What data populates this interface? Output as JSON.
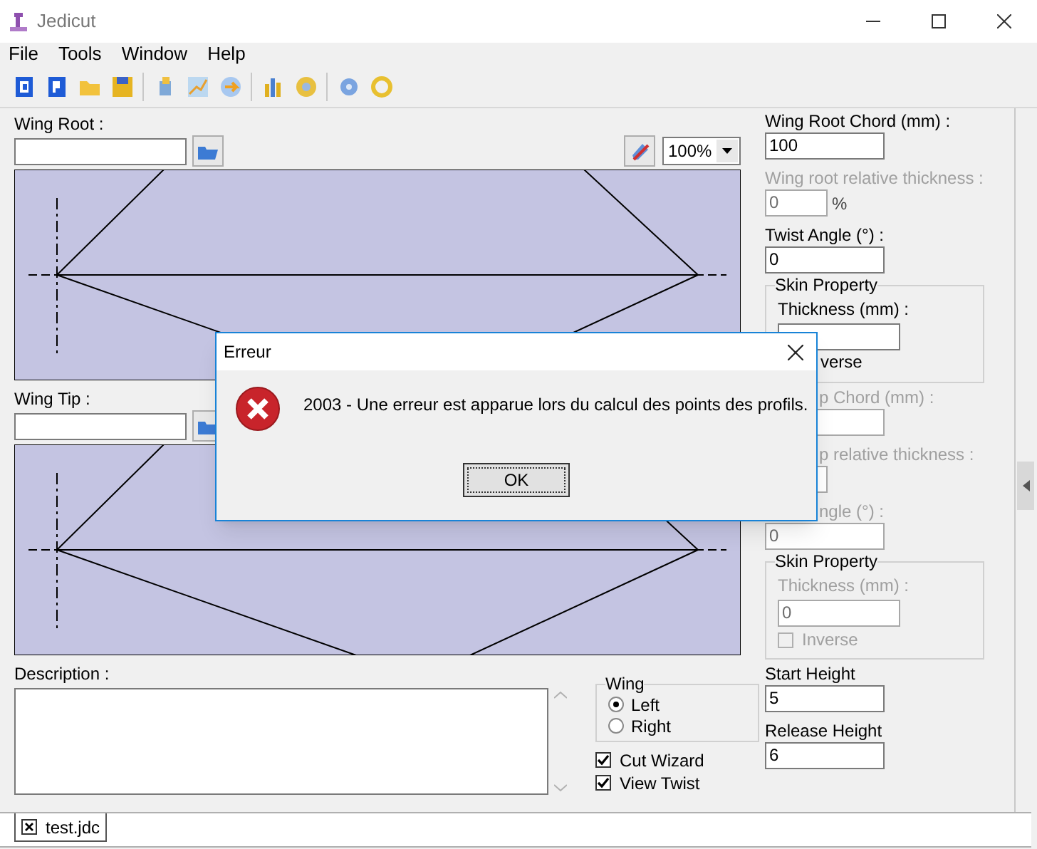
{
  "window": {
    "title": "Jedicut"
  },
  "menu": [
    "File",
    "Tools",
    "Window",
    "Help"
  ],
  "wing_root": {
    "label": "Wing Root :",
    "zoom": "100%"
  },
  "wing_tip": {
    "label": "Wing Tip :"
  },
  "description": {
    "label": "Description :"
  },
  "wing_side": {
    "title": "Wing",
    "options": [
      {
        "label": "Left",
        "selected": true
      },
      {
        "label": "Right",
        "selected": false
      }
    ]
  },
  "options": [
    {
      "label": "Cut Wizard",
      "checked": true
    },
    {
      "label": "View Twist",
      "checked": true
    }
  ],
  "right_panel": [
    {
      "kind": "field",
      "label": "Wing Root Chord (mm) :",
      "value": "100",
      "disabled": false
    },
    {
      "kind": "short_field",
      "label": "Wing root relative thickness :",
      "value": "0",
      "unit": "%",
      "disabled": true
    },
    {
      "kind": "field",
      "label": "Twist Angle (°) :",
      "value": "0",
      "disabled": false
    },
    {
      "kind": "group",
      "title": "Skin Property",
      "thickness_label": "Thickness (mm) :",
      "disabled": false,
      "inverse": {
        "label": "verse",
        "clipped_left": true
      }
    },
    {
      "kind": "field",
      "label": "p Chord (mm) :",
      "clipped_left": true,
      "disabled": true
    },
    {
      "kind": "short_field",
      "label": "p relative thickness :",
      "clipped_left": true,
      "disabled": true
    },
    {
      "kind": "field",
      "label": "ngle (°) :",
      "clipped_left": true,
      "value": "0",
      "disabled": true
    },
    {
      "kind": "group",
      "title": "Skin Property",
      "thickness_label": "Thickness (mm) :",
      "value": "0",
      "disabled": true,
      "inverse": {
        "label": "Inverse",
        "checked": false
      }
    },
    {
      "kind": "field",
      "label": "Start Height",
      "value": "5",
      "disabled": false
    },
    {
      "kind": "field",
      "label": "Release Height",
      "value": "6",
      "disabled": false
    }
  ],
  "tabs": [
    {
      "label": "test.jdc",
      "selected": true
    }
  ],
  "dialog": {
    "title": "Erreur",
    "message": "2003 - Une erreur est apparue lors du calcul des points des profils.",
    "button": "OK"
  }
}
